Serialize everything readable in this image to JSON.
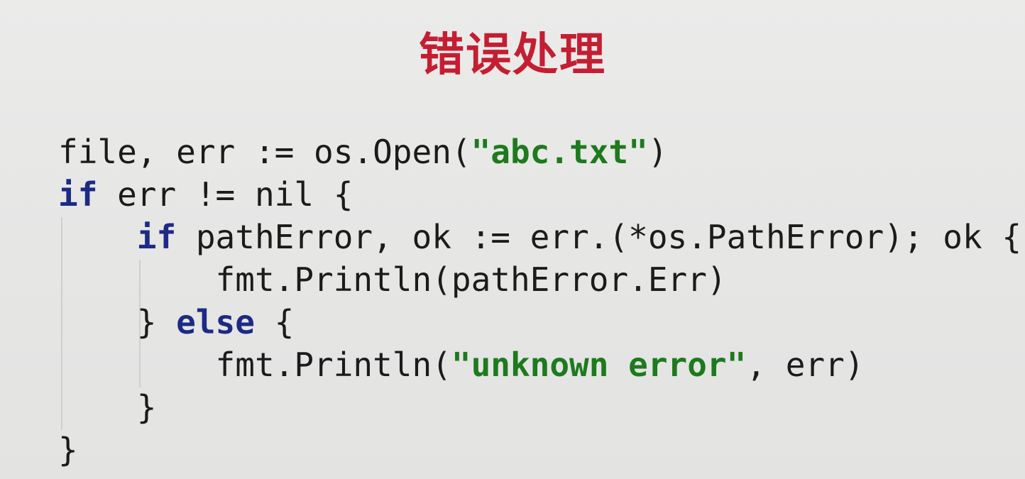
{
  "title": "错误处理",
  "code_lines": [
    {
      "segments": [
        {
          "text": "file, err := os.Open(",
          "kind": "plain"
        },
        {
          "text": "\"abc.txt\"",
          "kind": "string"
        },
        {
          "text": ")",
          "kind": "plain"
        }
      ]
    },
    {
      "segments": [
        {
          "text": "if",
          "kind": "keyword"
        },
        {
          "text": " err != nil {",
          "kind": "plain"
        }
      ]
    },
    {
      "segments": [
        {
          "text": "    ",
          "kind": "plain"
        },
        {
          "text": "if",
          "kind": "keyword"
        },
        {
          "text": " pathError, ok := err.(*os.PathError); ok {",
          "kind": "plain"
        }
      ]
    },
    {
      "segments": [
        {
          "text": "        fmt.Println(pathError.Err)",
          "kind": "plain"
        }
      ]
    },
    {
      "segments": [
        {
          "text": "    } ",
          "kind": "plain"
        },
        {
          "text": "else",
          "kind": "keyword"
        },
        {
          "text": " {",
          "kind": "plain"
        }
      ]
    },
    {
      "segments": [
        {
          "text": "        fmt.Println(",
          "kind": "plain"
        },
        {
          "text": "\"unknown error\"",
          "kind": "string"
        },
        {
          "text": ", err)",
          "kind": "plain"
        }
      ]
    },
    {
      "segments": [
        {
          "text": "    }",
          "kind": "plain"
        }
      ]
    },
    {
      "segments": [
        {
          "text": "}",
          "kind": "plain"
        }
      ]
    }
  ]
}
